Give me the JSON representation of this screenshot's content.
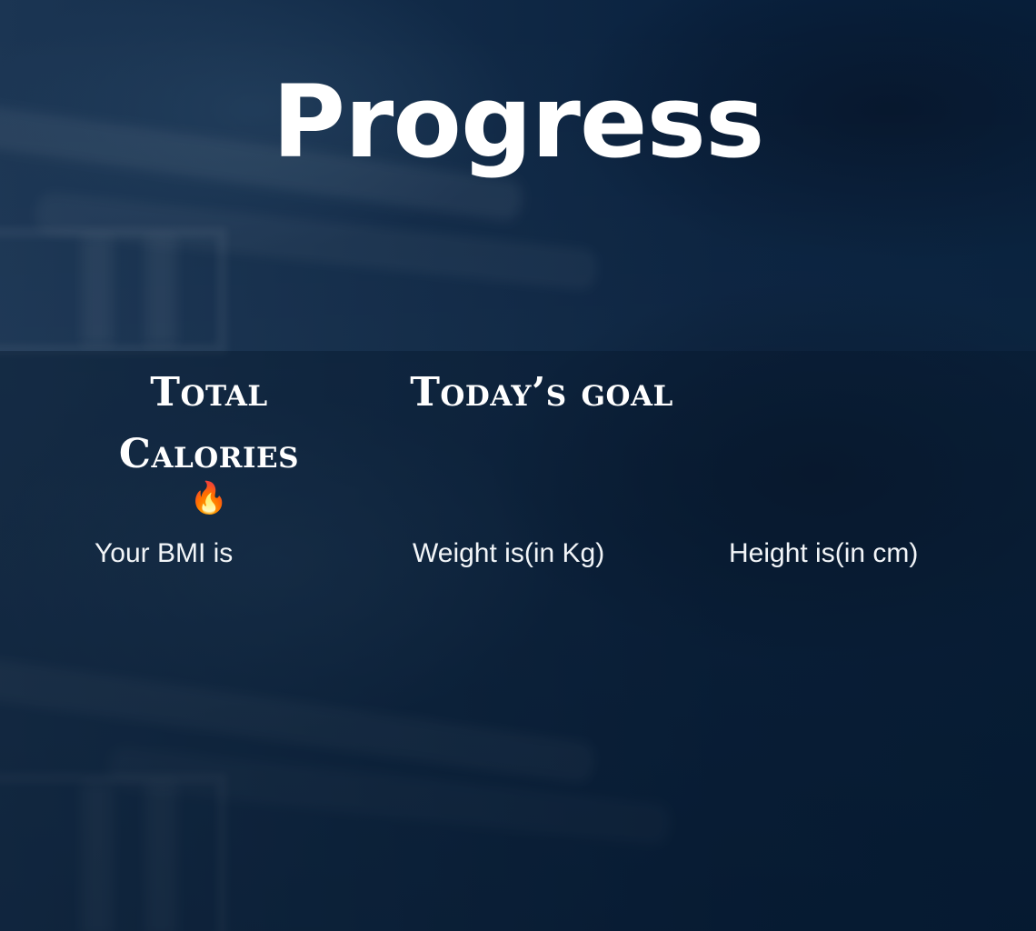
{
  "page": {
    "title": "Progress"
  },
  "stats": {
    "calories_title": "Total Calories",
    "calories_emoji": "🔥",
    "goal_title": "Today’s goal"
  },
  "labels": {
    "bmi": "Your BMI is",
    "weight": "Weight is(in Kg)",
    "height": "Height is(in cm)"
  },
  "icons": {
    "calories": "fire-icon"
  },
  "colors": {
    "background": "#0b2440",
    "text": "#ffffff"
  }
}
